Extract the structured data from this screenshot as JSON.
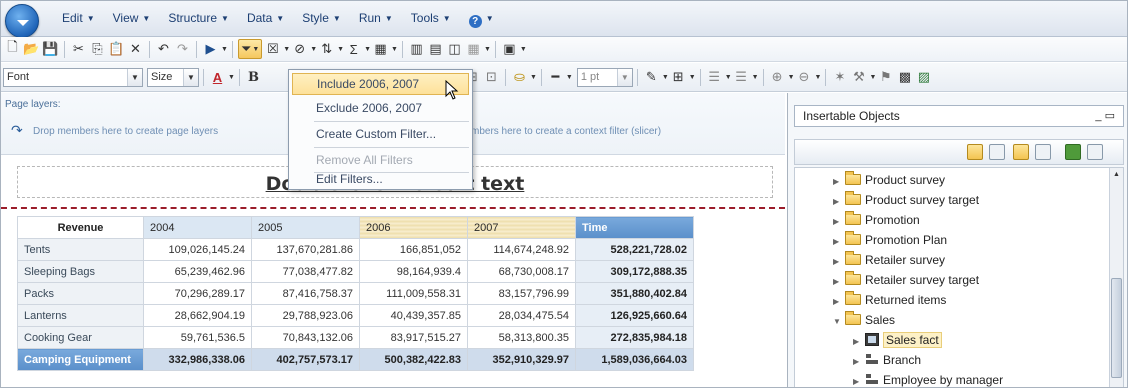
{
  "menubar": {
    "items": [
      "Edit",
      "View",
      "Structure",
      "Data",
      "Style",
      "Run",
      "Tools"
    ],
    "help_icon": "help-icon"
  },
  "format_toolbar": {
    "font_value": "Font",
    "size_value": "Size",
    "bold_label": "B",
    "line_width_value": "1 pt"
  },
  "filter_menu": {
    "items": [
      {
        "label": "Include 2006, 2007",
        "state": "selected"
      },
      {
        "label": "Exclude 2006, 2007",
        "state": "enabled"
      },
      {
        "label": "Create Custom Filter...",
        "state": "enabled"
      },
      {
        "label": "Remove All Filters",
        "state": "disabled"
      },
      {
        "label": "Edit Filters...",
        "state": "enabled"
      }
    ]
  },
  "page_layers": {
    "title": "Page layers:",
    "hint": "Drop members here to create page layers",
    "slicer_hint": "mbers here to create a context filter (slicer)"
  },
  "report": {
    "title": "Double-click to edit text",
    "crosstab": {
      "corner_label": "Revenue",
      "columns": [
        "2004",
        "2005",
        "2006",
        "2007",
        "Time"
      ],
      "rows": [
        {
          "label": "Tents",
          "values": [
            "109,026,145.24",
            "137,670,281.86",
            "166,851,052",
            "114,674,248.92",
            "528,221,728.02"
          ]
        },
        {
          "label": "Sleeping Bags",
          "values": [
            "65,239,462.96",
            "77,038,477.82",
            "98,164,939.4",
            "68,730,008.17",
            "309,172,888.35"
          ]
        },
        {
          "label": "Packs",
          "values": [
            "70,296,289.17",
            "87,416,758.37",
            "111,009,558.31",
            "83,157,796.99",
            "351,880,402.84"
          ]
        },
        {
          "label": "Lanterns",
          "values": [
            "28,662,904.19",
            "29,788,923.06",
            "40,439,357.85",
            "28,034,475.54",
            "126,925,660.64"
          ]
        },
        {
          "label": "Cooking Gear",
          "values": [
            "59,761,536.5",
            "70,843,132.06",
            "83,917,515.27",
            "58,313,800.35",
            "272,835,984.18"
          ]
        }
      ],
      "summary": {
        "label": "Camping Equipment",
        "values": [
          "332,986,338.06",
          "402,757,573.17",
          "500,382,422.83",
          "352,910,329.97",
          "1,589,036,664.03"
        ]
      }
    }
  },
  "insertable_objects": {
    "title": "Insertable Objects",
    "controls": "_ ▭",
    "tree": [
      {
        "label": "Product survey",
        "type": "folder",
        "expanded": false
      },
      {
        "label": "Product survey target",
        "type": "folder",
        "expanded": false
      },
      {
        "label": "Promotion",
        "type": "folder",
        "expanded": false
      },
      {
        "label": "Promotion Plan",
        "type": "folder",
        "expanded": false
      },
      {
        "label": "Retailer survey",
        "type": "folder",
        "expanded": false
      },
      {
        "label": "Retailer survey target",
        "type": "folder",
        "expanded": false
      },
      {
        "label": "Returned items",
        "type": "folder",
        "expanded": false
      },
      {
        "label": "Sales",
        "type": "folder-open",
        "expanded": true
      },
      {
        "label": "Sales fact",
        "type": "fact",
        "expanded": false,
        "selected": true
      },
      {
        "label": "Branch",
        "type": "dimension",
        "expanded": false
      },
      {
        "label": "Employee by manager",
        "type": "dimension",
        "expanded": false
      }
    ]
  },
  "colors": {
    "menu_text": "#1d3f73",
    "header_blue": "#5a8fca",
    "highlight_yellow": "#fde19a",
    "page_break_red": "#9b1c2a"
  }
}
